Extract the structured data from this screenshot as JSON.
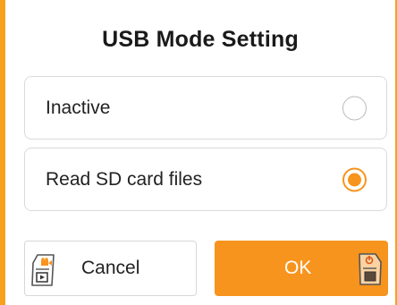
{
  "dialog": {
    "title": "USB Mode Setting",
    "options": [
      {
        "label": "Inactive",
        "selected": false
      },
      {
        "label": "Read SD card files",
        "selected": true
      }
    ],
    "cancel_label": "Cancel",
    "ok_label": "OK"
  },
  "icons": {
    "cancel_key": "camera-key-icon",
    "ok_key": "power-key-icon"
  },
  "colors": {
    "accent": "#f7941d",
    "frame": "#f6a01e"
  }
}
